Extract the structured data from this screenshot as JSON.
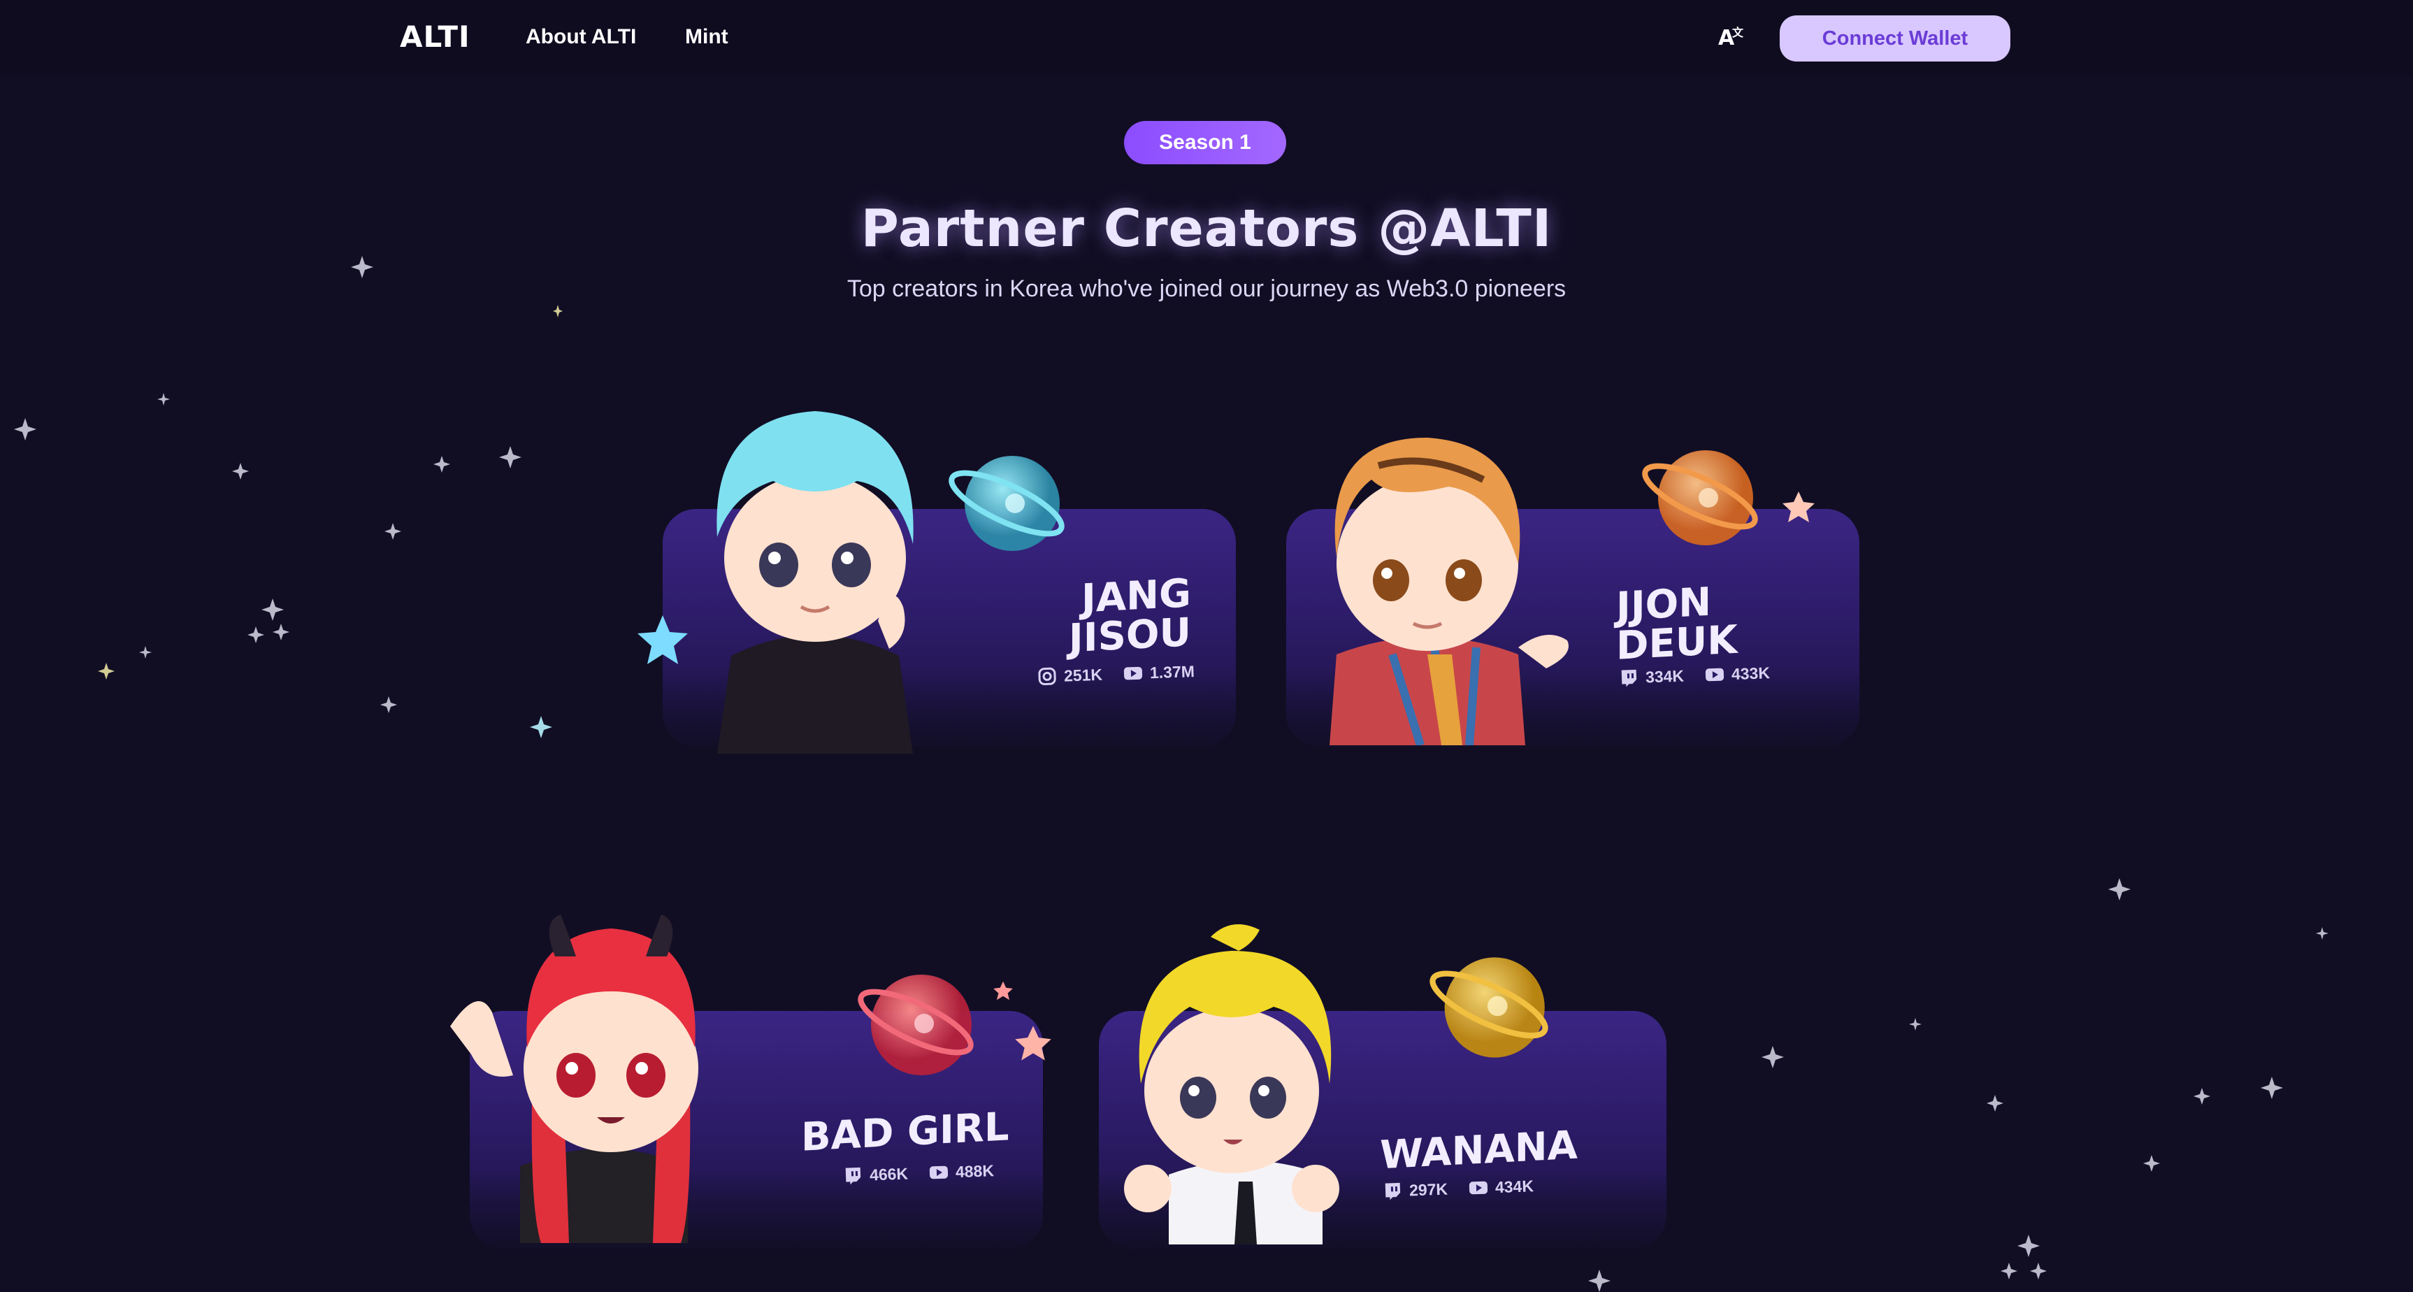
{
  "nav": {
    "logo": "ALTI",
    "about": "About ALTI",
    "mint": "Mint",
    "language_icon": "translate-icon",
    "connect_wallet": "Connect Wallet"
  },
  "hero": {
    "badge": "Season 1",
    "title": "Partner Creators @ALTI",
    "subtitle": "Top creators in Korea who've joined our journey as Web3.0 pioneers"
  },
  "colors": {
    "background": "#110e24",
    "accent": "#8b4dff",
    "button_bg": "#d9c8ff",
    "button_text": "#6a3cd6",
    "card": "#2d1d6b"
  },
  "creators": [
    {
      "name": "JANG\nJISOU",
      "stats": [
        {
          "icon": "instagram-icon",
          "value": "251K"
        },
        {
          "icon": "youtube-icon",
          "value": "1.37M"
        }
      ]
    },
    {
      "name": "JJON\nDEUK",
      "stats": [
        {
          "icon": "twitch-icon",
          "value": "334K"
        },
        {
          "icon": "youtube-icon",
          "value": "433K"
        }
      ]
    },
    {
      "name": "BAD GIRL",
      "stats": [
        {
          "icon": "twitch-icon",
          "value": "466K"
        },
        {
          "icon": "youtube-icon",
          "value": "488K"
        }
      ]
    },
    {
      "name": "WANANA",
      "stats": [
        {
          "icon": "twitch-icon",
          "value": "297K"
        },
        {
          "icon": "youtube-icon",
          "value": "434K"
        }
      ]
    }
  ]
}
